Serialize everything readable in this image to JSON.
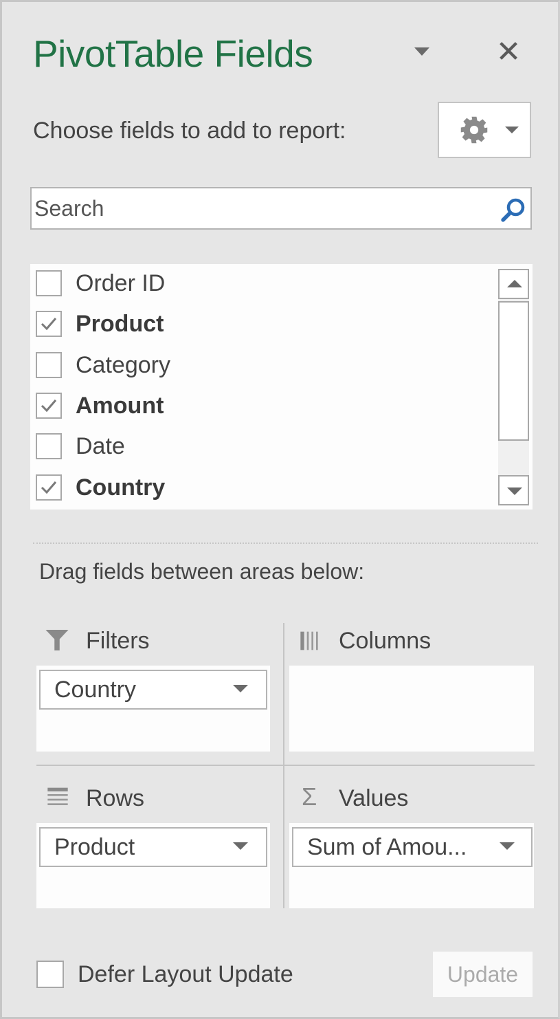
{
  "header": {
    "title": "PivotTable Fields",
    "title_color": "#217346",
    "dropdown_icon": "caret-down-icon",
    "close_icon": "close-icon",
    "close_glyph": "✕"
  },
  "chooser": {
    "label": "Choose fields to add to report:",
    "tools_icon": "gear-icon"
  },
  "search": {
    "placeholder": "Search",
    "value": "",
    "icon": "search-icon",
    "icon_color": "#2b6cb5"
  },
  "fields": [
    {
      "label": "Order ID",
      "checked": false
    },
    {
      "label": "Product",
      "checked": true
    },
    {
      "label": "Category",
      "checked": false
    },
    {
      "label": "Amount",
      "checked": true
    },
    {
      "label": "Date",
      "checked": false
    },
    {
      "label": "Country",
      "checked": true
    }
  ],
  "areas_section": {
    "label": "Drag fields between areas below:"
  },
  "areas": {
    "filters": {
      "label": "Filters",
      "icon": "filter-icon",
      "items": [
        "Country"
      ]
    },
    "columns": {
      "label": "Columns",
      "icon": "columns-icon",
      "items": []
    },
    "rows": {
      "label": "Rows",
      "icon": "rows-icon",
      "items": [
        "Product"
      ]
    },
    "values": {
      "label": "Values",
      "icon": "sigma-icon",
      "icon_glyph": "Σ",
      "items": [
        "Sum of Amou..."
      ]
    }
  },
  "footer": {
    "defer_label": "Defer Layout Update",
    "defer_checked": false,
    "update_label": "Update",
    "update_enabled": false
  }
}
